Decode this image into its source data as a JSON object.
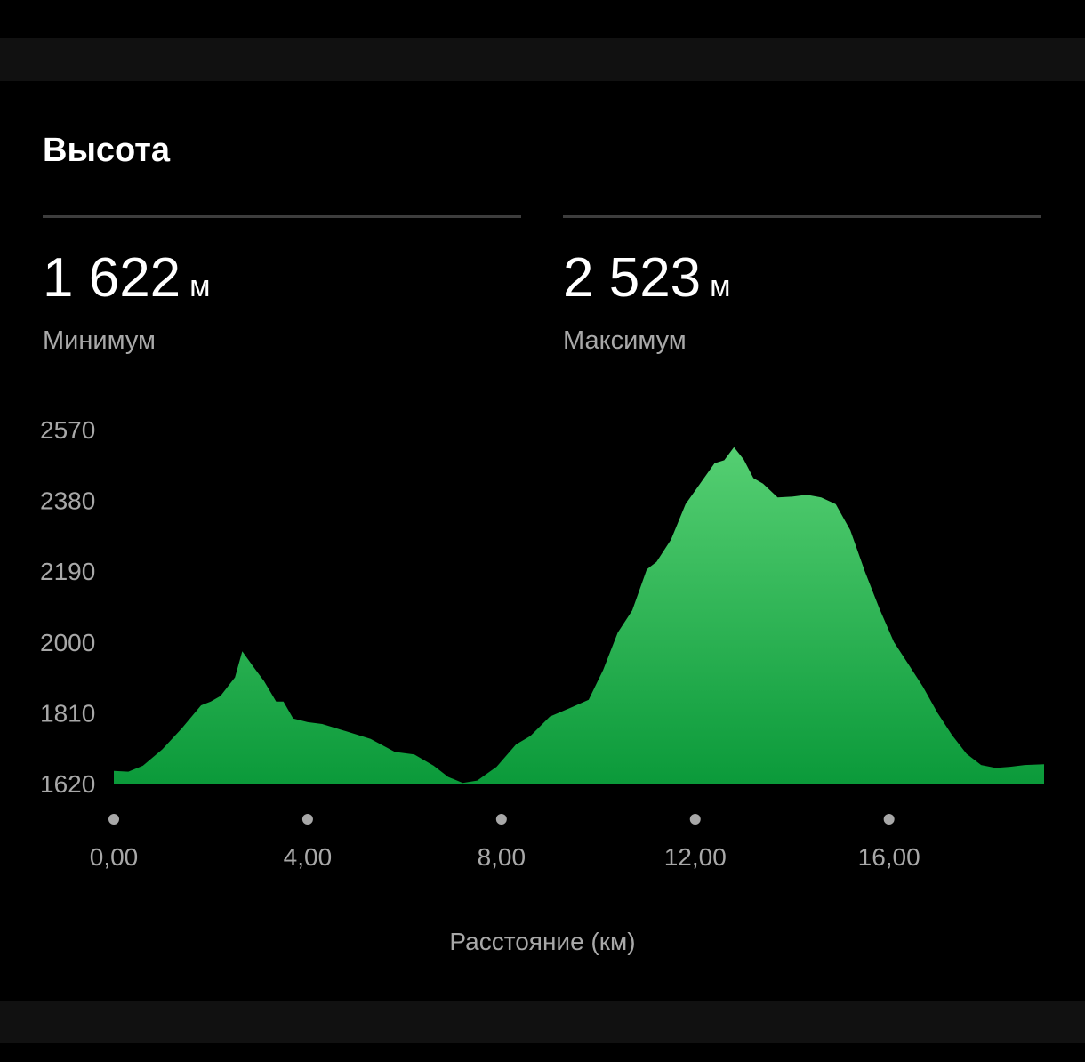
{
  "header": {
    "title": "Высота"
  },
  "stats": [
    {
      "value": "1 622",
      "unit": "м",
      "label": "Минимум"
    },
    {
      "value": "2 523",
      "unit": "м",
      "label": "Максимум"
    }
  ],
  "chart_data": {
    "type": "area",
    "xlabel": "Расстояние (км)",
    "ylabel": "",
    "ylim": [
      1620,
      2570
    ],
    "xlim": [
      0,
      19.2
    ],
    "y_ticks": [
      "2570",
      "2380",
      "2190",
      "2000",
      "1810",
      "1620"
    ],
    "x_ticks": [
      "0,00",
      "4,00",
      "8,00",
      "12,00",
      "16,00"
    ],
    "x_tick_values": [
      0,
      4,
      8,
      12,
      16
    ],
    "y_tick_values": [
      2570,
      2380,
      2190,
      2000,
      1810,
      1620
    ],
    "fill_color_top": "#55cf72",
    "fill_color_bottom": "#0b9a3a",
    "grid": false,
    "series": [
      {
        "x": [
          0,
          0.3,
          0.6,
          1.0,
          1.4,
          1.8,
          2.0,
          2.2,
          2.5,
          2.65,
          2.9,
          3.1,
          3.35,
          3.5,
          3.7,
          4.0,
          4.3,
          4.8,
          5.3,
          5.8,
          6.2,
          6.6,
          6.9,
          7.2,
          7.5,
          7.9,
          8.3,
          8.6,
          9.0,
          9.4,
          9.8,
          10.1,
          10.4,
          10.7,
          11.0,
          11.2,
          11.5,
          11.8,
          12.1,
          12.4,
          12.6,
          12.8,
          13.0,
          13.2,
          13.4,
          13.7,
          14.0,
          14.3,
          14.6,
          14.9,
          15.2,
          15.5,
          15.8,
          16.1,
          16.4,
          16.7,
          17.0,
          17.3,
          17.6,
          17.9,
          18.2,
          18.5,
          18.8,
          19.2
        ],
        "values": [
          1654,
          1652,
          1668,
          1712,
          1768,
          1830,
          1840,
          1855,
          1905,
          1975,
          1930,
          1895,
          1840,
          1840,
          1795,
          1785,
          1780,
          1760,
          1740,
          1705,
          1698,
          1668,
          1638,
          1622,
          1628,
          1665,
          1725,
          1748,
          1800,
          1822,
          1845,
          1925,
          2025,
          2085,
          2195,
          2215,
          2275,
          2370,
          2425,
          2480,
          2488,
          2523,
          2490,
          2440,
          2425,
          2388,
          2390,
          2395,
          2388,
          2370,
          2300,
          2190,
          2090,
          2000,
          1940,
          1880,
          1810,
          1750,
          1700,
          1670,
          1662,
          1665,
          1670,
          1672
        ]
      }
    ]
  }
}
